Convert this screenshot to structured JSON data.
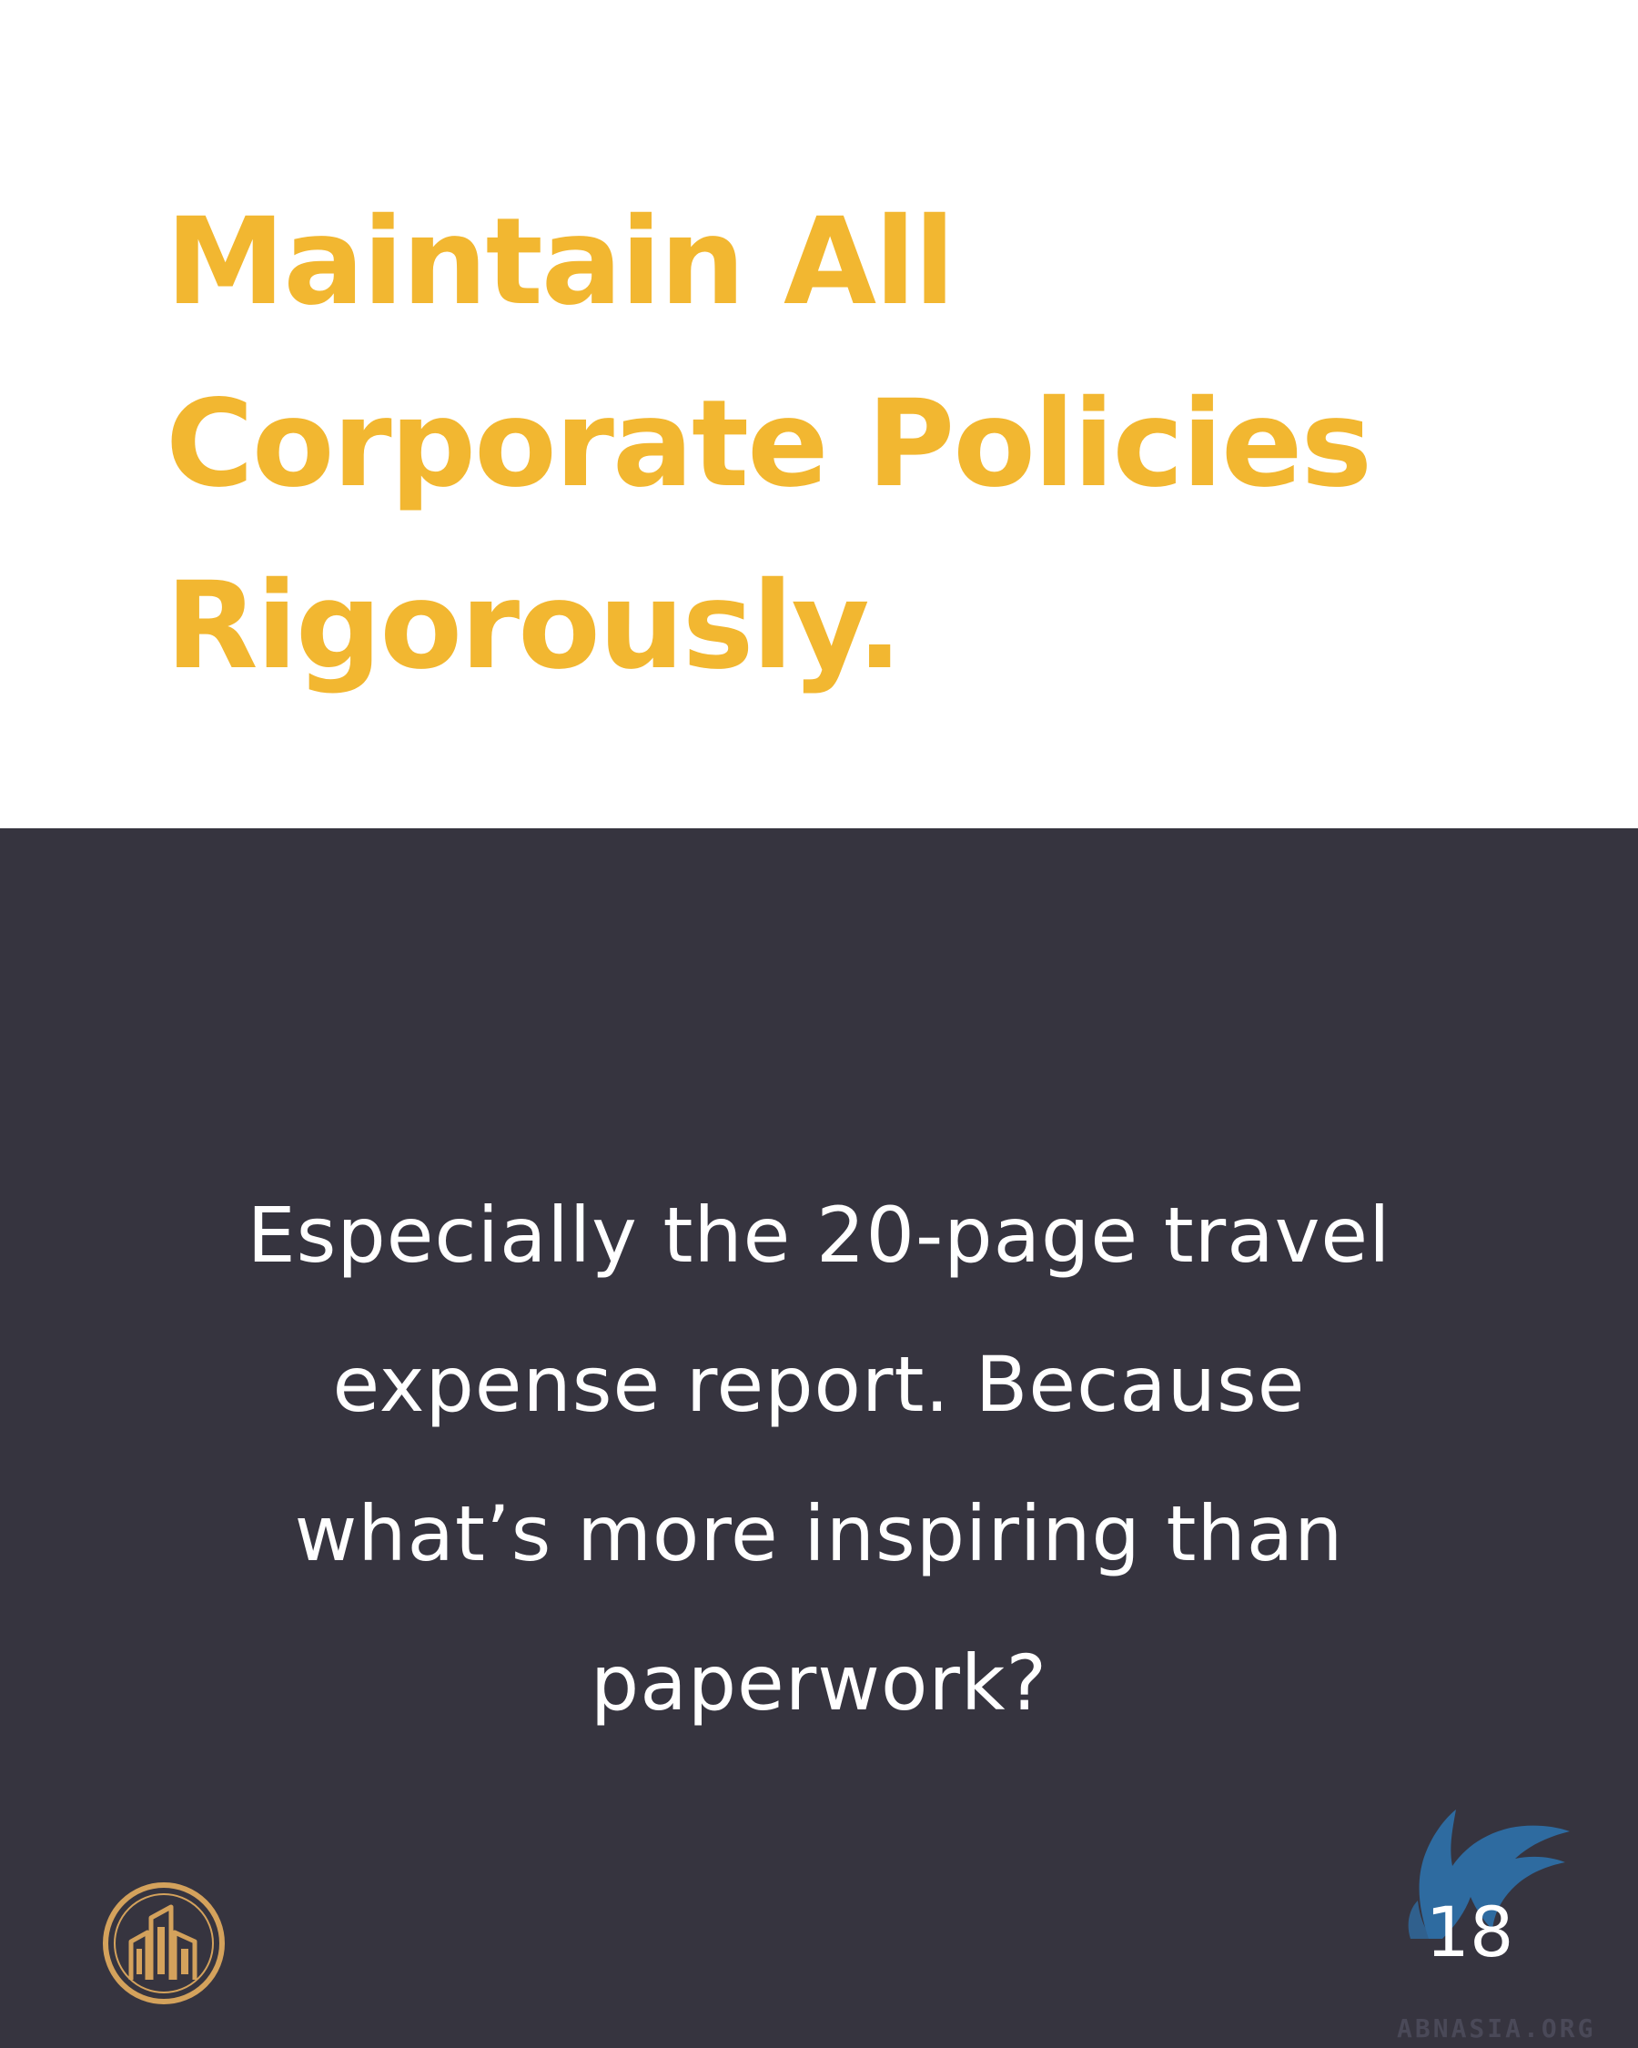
{
  "headline": {
    "lines": [
      "Maintain All",
      "Corporate Policies",
      "Rigorously."
    ]
  },
  "body": {
    "lines": [
      "Especially the 20-page travel",
      "expense report. Because",
      "what’s more inspiring than",
      "paperwork?"
    ]
  },
  "footer": {
    "page_number": "18",
    "watermark_text": "ABNASIA.ORG",
    "logo_icon": "gold-buildings-circle-logo",
    "watermark_icon": "blue-griffin-watermark"
  },
  "colors": {
    "accent": "#F2B731",
    "dark_panel": "#36343F",
    "logo_gold": "#D4A25C",
    "watermark_blue": "#2E6EA6"
  }
}
